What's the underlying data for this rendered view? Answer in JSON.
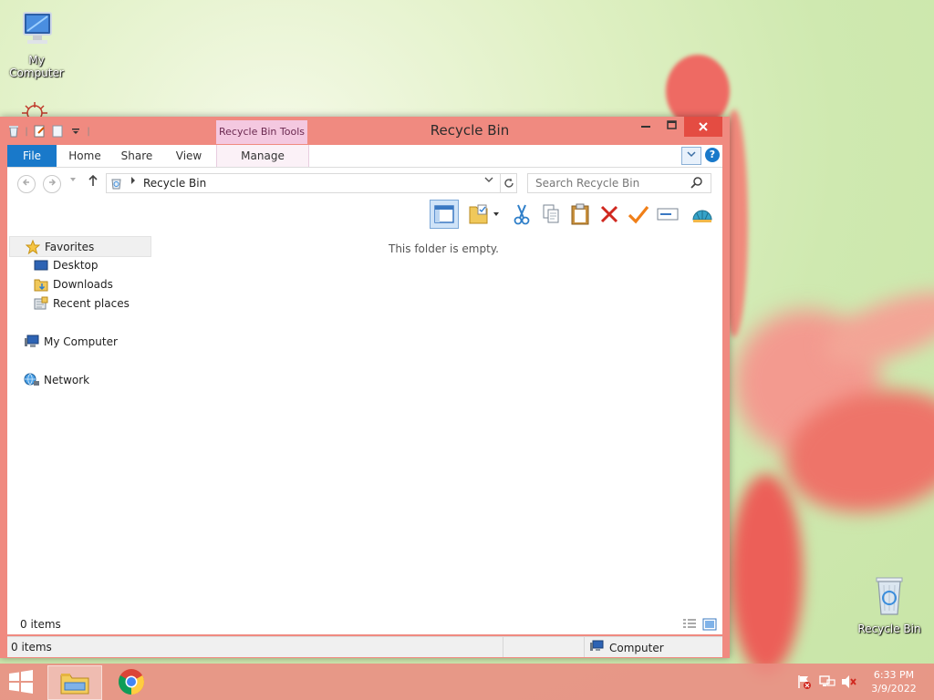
{
  "desktop": {
    "icons": [
      {
        "label": "My Computer"
      },
      {
        "label": "Recycle Bin"
      }
    ]
  },
  "window": {
    "title": "Recycle Bin",
    "context_tab": "Recycle Bin Tools",
    "ribbon_tabs": {
      "file": "File",
      "home": "Home",
      "share": "Share",
      "view": "View",
      "manage": "Manage"
    },
    "help_label": "?",
    "address": {
      "path": "Recycle Bin"
    },
    "search": {
      "placeholder": "Search Recycle Bin"
    },
    "nav_pane": {
      "favorites": "Favorites",
      "desktop": "Desktop",
      "downloads": "Downloads",
      "recent_places": "Recent places",
      "my_computer": "My Computer",
      "network": "Network"
    },
    "content": {
      "empty_message": "This folder is empty."
    },
    "items_count": "0 items",
    "status": {
      "left": "0 items",
      "location": "Computer"
    }
  },
  "taskbar": {
    "clock_time": "6:33 PM",
    "clock_date": "3/9/2022"
  },
  "colors": {
    "window_frame": "#f08a80",
    "file_tab": "#1979ca",
    "context_tab": "#f4c8e0",
    "close_button": "#e44c42"
  }
}
